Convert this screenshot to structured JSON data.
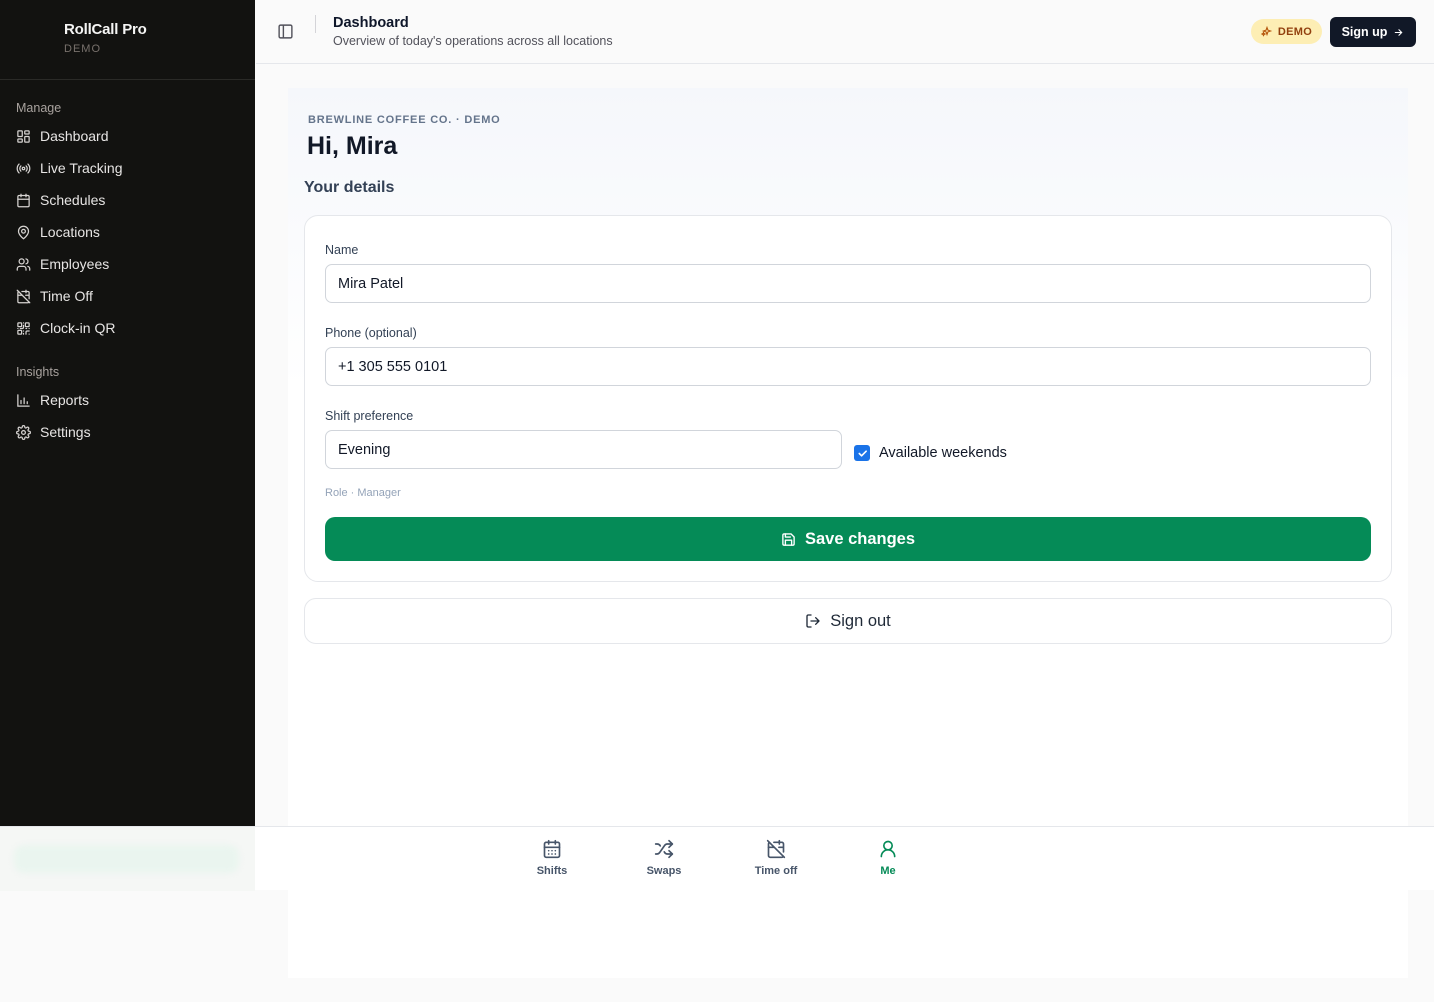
{
  "app": {
    "name": "RollCall Pro",
    "tag": "DEMO"
  },
  "sidebar": {
    "sections": [
      {
        "heading": "Manage",
        "items": [
          {
            "label": "Dashboard",
            "icon": "dashboard-grid-icon"
          },
          {
            "label": "Live Tracking",
            "icon": "radio-signal-icon"
          },
          {
            "label": "Schedules",
            "icon": "calendar-icon"
          },
          {
            "label": "Locations",
            "icon": "map-pin-icon"
          },
          {
            "label": "Employees",
            "icon": "users-icon"
          },
          {
            "label": "Time Off",
            "icon": "calendar-off-icon"
          },
          {
            "label": "Clock-in QR",
            "icon": "qr-code-icon"
          }
        ]
      },
      {
        "heading": "Insights",
        "items": [
          {
            "label": "Reports",
            "icon": "bar-chart-icon"
          },
          {
            "label": "Settings",
            "icon": "gear-icon"
          }
        ]
      }
    ]
  },
  "header": {
    "title": "Dashboard",
    "subtitle": "Overview of today's operations across all locations",
    "badge": "DEMO",
    "signup_label": "Sign up"
  },
  "main": {
    "org_line": "BREWLINE COFFEE CO. · DEMO",
    "greeting": "Hi, Mira",
    "section_title": "Your details",
    "form": {
      "name_label": "Name",
      "name_value": "Mira Patel",
      "phone_label": "Phone (optional)",
      "phone_value": "+1 305 555 0101",
      "shift_label": "Shift preference",
      "shift_value": "Evening",
      "weekends_label": "Available weekends",
      "weekends_checked": true,
      "role_line": "Role · Manager",
      "save_label": "Save changes"
    },
    "signout_label": "Sign out"
  },
  "bottom_nav": {
    "tabs": [
      {
        "label": "Shifts",
        "icon": "calendar-icon"
      },
      {
        "label": "Swaps",
        "icon": "shuffle-icon"
      },
      {
        "label": "Time off",
        "icon": "calendar-off-icon"
      },
      {
        "label": "Me",
        "icon": "user-icon",
        "active": true
      }
    ]
  },
  "colors": {
    "sidebar_bg": "#121210",
    "accent_green": "#058b57",
    "dark_button": "#111827",
    "badge_bg": "#fdeeb4"
  }
}
